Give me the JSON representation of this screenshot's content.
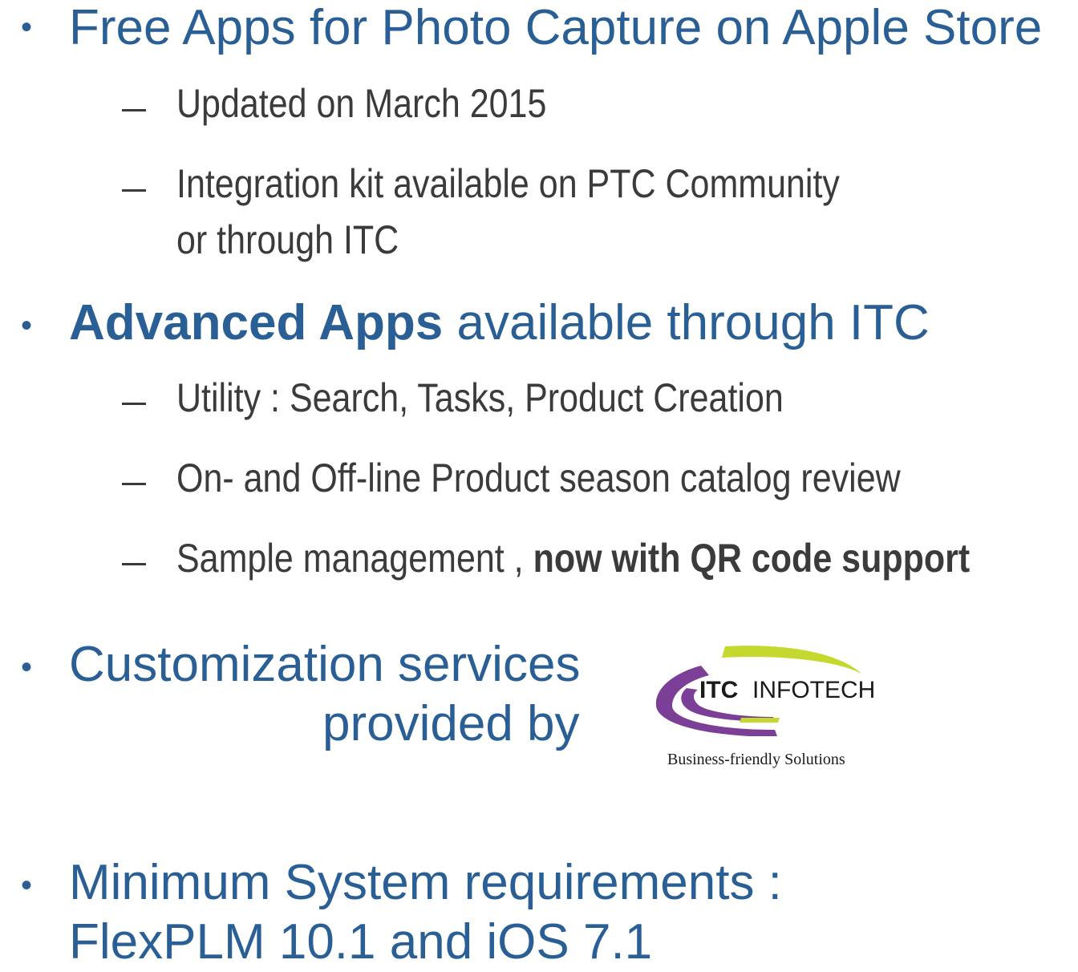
{
  "slide": {
    "bullets": [
      {
        "text": "Free Apps for Photo Capture on Apple Store",
        "subitems": [
          "Updated on March 2015",
          "Integration kit available on PTC Community",
          "or through ITC"
        ]
      },
      {
        "bold": "Advanced Apps",
        "text": " available through ITC",
        "subitems": [
          "Utility : Search, Tasks, Product Creation",
          "On- and Off-line Product season catalog review",
          "Sample management , ",
          "now with QR code support"
        ]
      },
      {
        "text_line1": "Customization services",
        "text_line2": "provided by"
      },
      {
        "text_line1": "Minimum System requirements :",
        "text_line2": "FlexPLM 10.1 and iOS 7.1"
      }
    ],
    "logo": {
      "name_bold": "ITC",
      "name_regular": "INFOTECH",
      "tagline": "Business-friendly Solutions",
      "colors": {
        "green_swoosh": "#c5d82e",
        "purple_swoosh": "#7b3f98"
      }
    },
    "colors": {
      "heading": "#2a5f95",
      "body": "#3b3b3b"
    }
  }
}
